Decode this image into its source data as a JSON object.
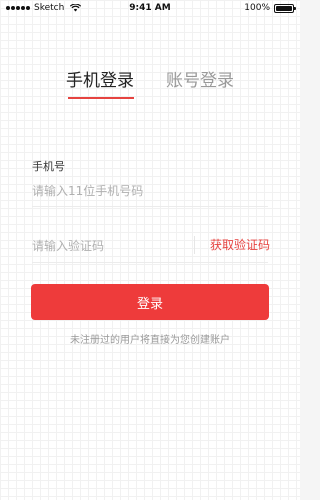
{
  "status_bar": {
    "carrier": "Sketch",
    "time": "9:41 AM",
    "battery_percent": "100%",
    "battery_level": 1.0
  },
  "tabs": [
    {
      "label": "手机登录",
      "active": true
    },
    {
      "label": "账号登录",
      "active": false
    }
  ],
  "form": {
    "phone_label": "手机号",
    "phone_value": "",
    "phone_placeholder": "请输入11位手机号码",
    "code_value": "",
    "code_placeholder": "请输入验证码",
    "get_code_label": "获取验证码",
    "login_label": "登录",
    "hint": "未注册过的用户将直接为您创建账户"
  },
  "colors": {
    "accent": "#e64340",
    "button": "#ee3b3b",
    "placeholder": "#b0b0b0"
  },
  "icons": [
    "signal-icon",
    "wifi-icon",
    "battery-icon"
  ]
}
